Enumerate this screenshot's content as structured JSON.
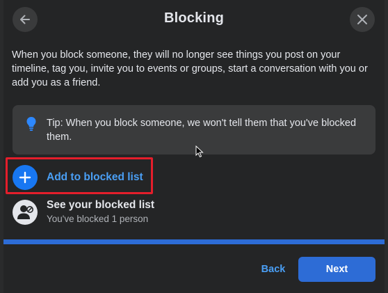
{
  "dialog": {
    "title": "Blocking",
    "back_icon": "arrow-left-icon",
    "close_icon": "close-icon"
  },
  "description": "When you block someone, they will no longer see things you post on your timeline, tag you, invite you to events or groups, start a conversation with you or add you as a friend.",
  "tip": {
    "icon": "lightbulb-icon",
    "text": "Tip: When you block someone, we won't tell them that you've blocked them."
  },
  "actions": {
    "add": {
      "icon": "plus-icon",
      "label": "Add to blocked list"
    },
    "see": {
      "icon": "blocked-user-icon",
      "title": "See your blocked list",
      "subtitle": "You've blocked 1 person"
    }
  },
  "progress": {
    "fraction": 1.0
  },
  "footer": {
    "back_label": "Back",
    "next_label": "Next"
  },
  "colors": {
    "accent": "#2d6cd6",
    "link": "#4a9ff5",
    "highlight": "#e41e2b",
    "dialog_bg": "#242526"
  }
}
